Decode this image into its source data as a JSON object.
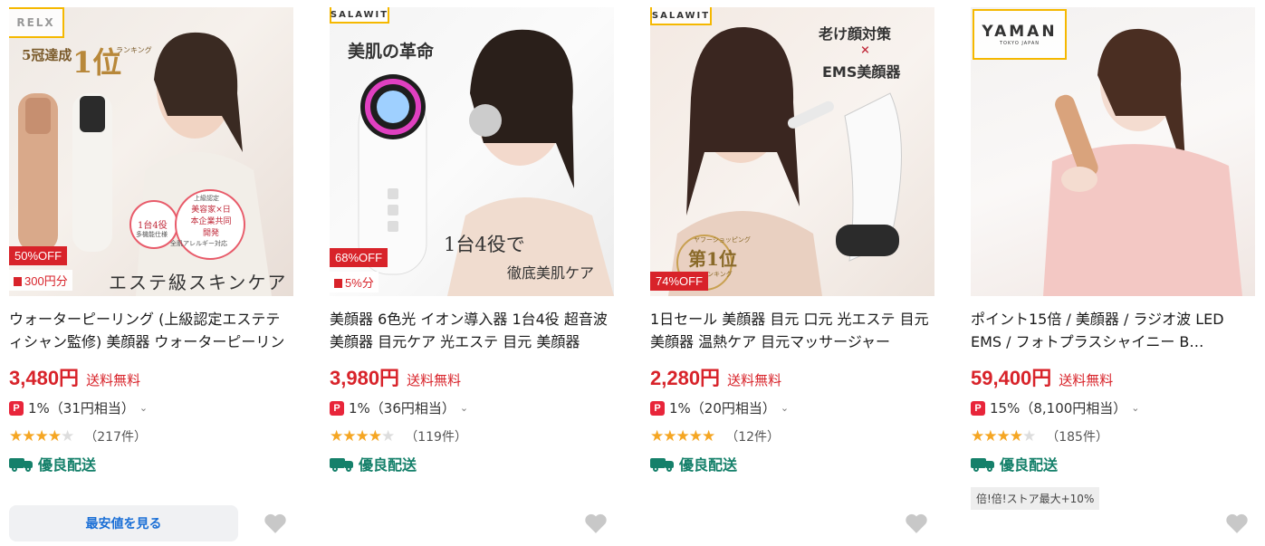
{
  "products": [
    {
      "brand_logo": "RELX",
      "image_badges": {
        "discount": "50%OFF",
        "points": "300円分"
      },
      "image_text": [
        "5冠達成",
        "1位",
        "ランキング",
        "1台4役",
        "多機能仕様",
        "全肌アレルギー対応",
        "美容家×日本企業共同開発",
        "上級認定",
        "エステ級スキンケア"
      ],
      "title": "ウォーターピーリング (上級認定エステティシャン監修) 美顔器 ウォーターピーリング",
      "price": "3,480円",
      "shipping": "送料無料",
      "point": "1%（31円相当）",
      "rating": 4.5,
      "reviews": "（217件）",
      "delivery": "優良配送",
      "action_button": "最安値を見る"
    },
    {
      "brand_logo": "SALAWIT",
      "image_badges": {
        "discount": "68%OFF",
        "points": "5%分"
      },
      "image_text": [
        "美肌の革命",
        "1台4役で",
        "徹底美肌ケア"
      ],
      "title": "美顔器 6色光 イオン導入器 1台4役 超音波美顔器 目元ケア 光エステ 目元 美顔器",
      "price": "3,980円",
      "shipping": "送料無料",
      "point": "1%（36円相当）",
      "rating": 4.5,
      "reviews": "（119件）",
      "delivery": "優良配送"
    },
    {
      "brand_logo": "SALAWIT",
      "image_badges": {
        "discount": "74%OFF"
      },
      "image_text": [
        "老け顔対策",
        "×",
        "EMS美顔器",
        "ヤフーショッピング",
        "第1位",
        "ランキング"
      ],
      "title": "1日セール 美顔器 目元 口元 光エステ 目元美顔器 温熱ケア 目元マッサージャー",
      "price": "2,280円",
      "shipping": "送料無料",
      "point": "1%（20円相当）",
      "rating": 5,
      "reviews": "（12件）",
      "delivery": "優良配送"
    },
    {
      "brand_logo": "YAMAN",
      "brand_tagline": "TOKYO JAPAN",
      "title": "ポイント15倍 / 美顔器 / ラジオ波 LED EMS / フォトプラスシャイニー B…",
      "price": "59,400円",
      "shipping": "送料無料",
      "point": "15%（8,100円相当）",
      "rating": 4.5,
      "reviews": "（185件）",
      "delivery": "優良配送",
      "store_badge": "倍!倍!ストア最大+10%"
    }
  ],
  "icons": {
    "point": "paypay-icon",
    "chevron": "chevron-down-icon",
    "delivery": "truck-icon",
    "favorite": "heart-icon",
    "star": "star-icon"
  },
  "colors": {
    "price": "#d8232a",
    "delivery": "#15806a",
    "star": "#f5a623",
    "brand_outline": "#f5b800",
    "link": "#1a6fd6",
    "heart": "#c8c8c8"
  }
}
